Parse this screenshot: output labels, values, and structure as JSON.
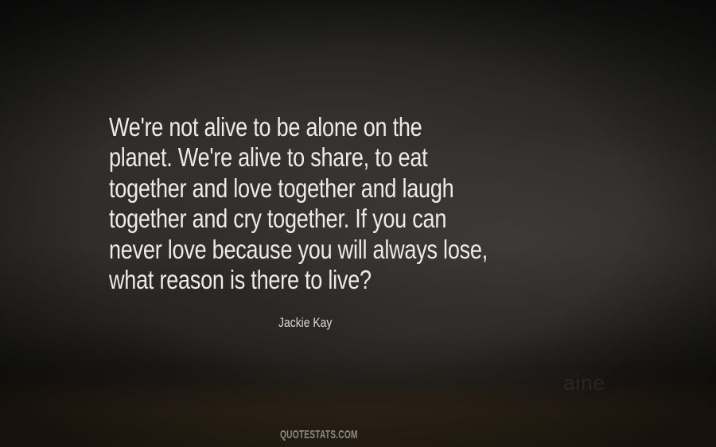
{
  "quote": {
    "lines": [
      "We're not alive to be alone on the",
      "planet. We're alive to share, to eat",
      "together and love together and laugh",
      "together and cry together. If you can",
      "never love because you will always lose,",
      "what reason is there to live?"
    ]
  },
  "author": "Jackie Kay",
  "footer": {
    "brand": "QUOTESTATS.COM"
  },
  "background_watermark": "aine"
}
